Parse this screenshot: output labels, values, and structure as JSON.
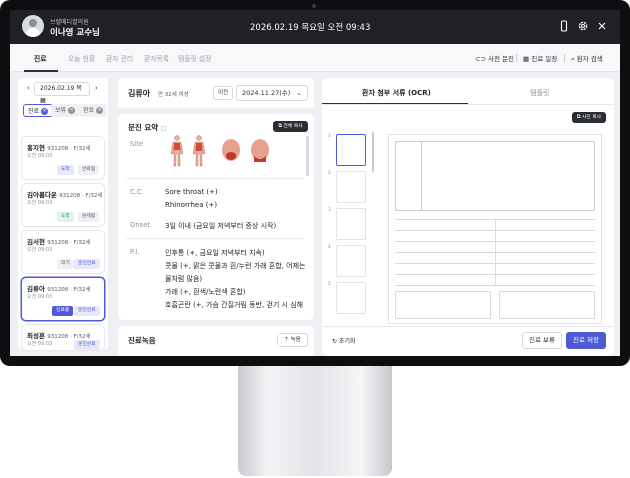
{
  "header": {
    "hospital": "브렐메디컬의원",
    "doctor": "이나영 교수님",
    "datetime": "2026.02.19 목요일 오전 09:43",
    "icons": [
      "phone-icon",
      "gear-icon",
      "close-icon"
    ]
  },
  "nav": {
    "tabs": [
      "진료",
      "오늘 현황",
      "환자 관리",
      "환자목록",
      "템플릿 설정"
    ],
    "right": [
      "사전 문진",
      "진료 일정",
      "환자 검색"
    ]
  },
  "patients": {
    "date": "2026.02.19 목",
    "filters": [
      "진료",
      "보류",
      "완료"
    ],
    "list": [
      {
        "name": "홍지현",
        "info": "931208 · F/32세",
        "time": "오전 09:03",
        "tags": [
          "도착",
          "완료됨"
        ]
      },
      {
        "name": "김아름다운",
        "info": "931208 · F/32세",
        "time": "오전 09:03",
        "tags": [
          "도착",
          "문제됨"
        ]
      },
      {
        "name": "김서현",
        "info": "931208 · F/32세",
        "time": "오전 09:03",
        "tags": [
          "대기",
          "문진완료"
        ]
      },
      {
        "name": "김류아",
        "info": "931208 · F/32세",
        "time": "오전 09:03",
        "tags": [
          "진료중",
          "문진완료"
        ]
      },
      {
        "name": "최성훈",
        "info": "931208 · F/32세",
        "time": "오전 09:03",
        "tags": [
          "문진완료"
        ]
      }
    ]
  },
  "record": {
    "patient_name": "김류아",
    "patient_info": "만 32세 여성",
    "prev_label": "이전",
    "visit_date": "2024.11.27(수)",
    "section_title": "문진 요약",
    "copy_all": "전체 복사",
    "site_label": "Site",
    "cc_label": "C.C.",
    "cc_lines": [
      "Sore throat (+)",
      "Rhinorrhea (+)"
    ],
    "onset_label": "Onset",
    "onset": "3일 이내 (금요일 저녁부터 증상 시작)",
    "pi_label": "P.I.",
    "pi_lines": [
      "인후통 (+, 금요일 저녁부터 지속)",
      "콧물 (+, 맑은 콧물과 흰/누런 가래 혼합, 어제는",
      "물처럼 많음)",
      "가래 (+, 흰색/노란색 혼합)",
      "호흡곤란 (+, 가슴 간질거림 동반, 걷기 시 심해"
    ],
    "recording_title": "진료녹음",
    "record_btn": "녹음"
  },
  "ocr": {
    "tabs": [
      "환자 첨부 서류 (OCR)",
      "템플릿"
    ],
    "copy_photo": "사진 복사",
    "pages": [
      "1",
      "2",
      "3",
      "4",
      "5"
    ],
    "reset": "초기화",
    "hold": "진료 보류",
    "save": "진료 저장",
    "accent": "#4f5bd5"
  }
}
